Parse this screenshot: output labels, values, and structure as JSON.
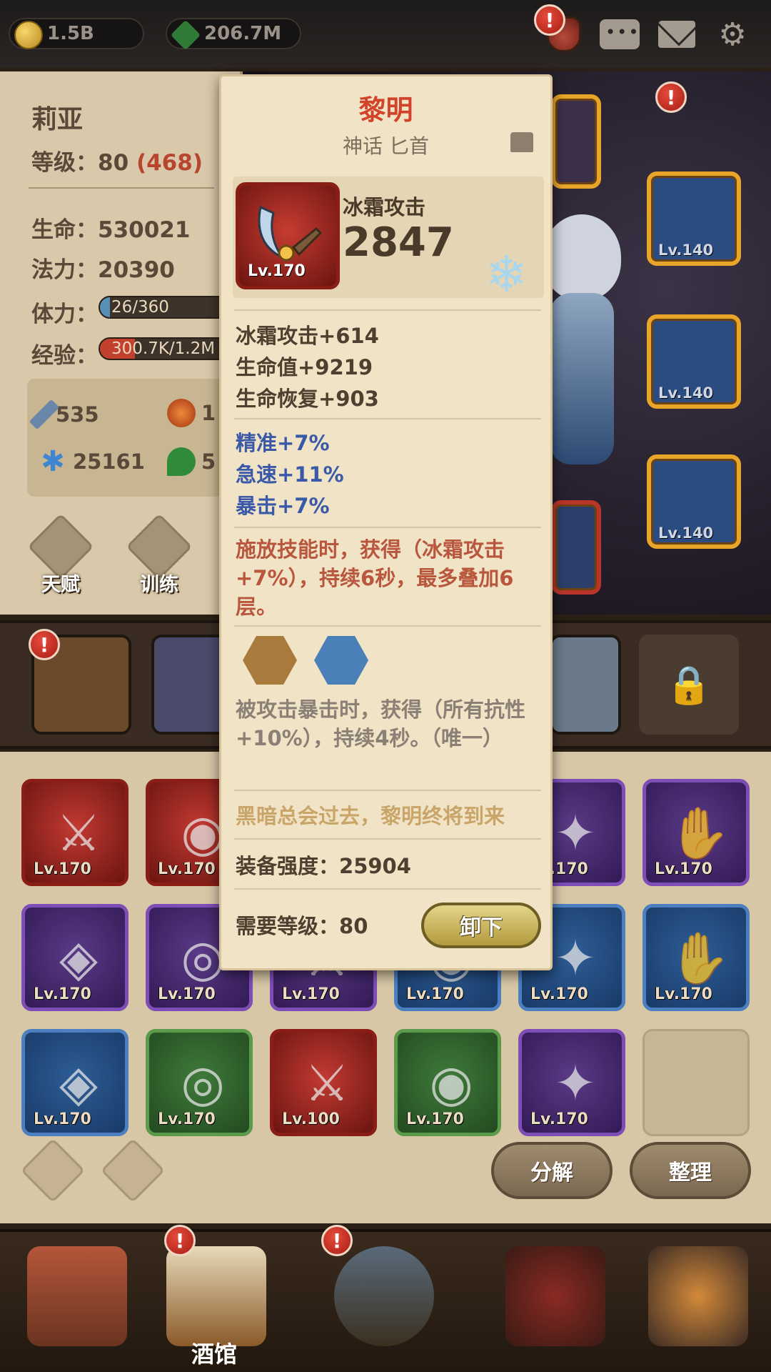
{
  "currencies": {
    "gold": "1.5B",
    "gems": "206.7M"
  },
  "top_icons": [
    "bag-icon",
    "chat-icon",
    "mail-icon",
    "gear-icon"
  ],
  "hero": {
    "name": "莉亚",
    "level_label": "等级：",
    "level": "80",
    "level_extra": "(468)",
    "hp_label": "生命：",
    "hp": "530021",
    "mp_label": "法力：",
    "mp": "20390",
    "stamina_label": "体力：",
    "stamina": "26/360",
    "stamina_fraction": 0.07,
    "exp_label": "经验：",
    "exp": "300.7K/1.2M",
    "exp_fraction": 0.25,
    "mini_stats": [
      {
        "icon": "sword-icon",
        "value": "535"
      },
      {
        "icon": "flame-icon",
        "value": "1"
      },
      {
        "icon": "frost-icon",
        "value": "25161"
      },
      {
        "icon": "leaf-icon",
        "value": "5"
      }
    ],
    "talent_label": "天赋",
    "training_label": "训练"
  },
  "equipped_slots": [
    {
      "level": "Lv.140"
    },
    {
      "level": "Lv.140"
    },
    {
      "level": "Lv.140"
    }
  ],
  "inventory": [
    {
      "level": "Lv.170",
      "rarity": "red"
    },
    {
      "level": "Lv.170",
      "rarity": "red"
    },
    {
      "level": "Lv.170",
      "rarity": "purple"
    },
    {
      "level": "Lv.170",
      "rarity": "purple"
    },
    {
      "level": "Lv.170",
      "rarity": "purple"
    },
    {
      "level": "Lv.170",
      "rarity": "purple"
    },
    {
      "level": "Lv.170",
      "rarity": "purple"
    },
    {
      "level": "Lv.170",
      "rarity": "blue"
    },
    {
      "level": "Lv.170",
      "rarity": "blue"
    },
    {
      "level": "Lv.170",
      "rarity": "blue"
    },
    {
      "level": "Lv.170",
      "rarity": "blue"
    },
    {
      "level": "Lv.170",
      "rarity": "green"
    },
    {
      "level": "Lv.100",
      "rarity": "red"
    },
    {
      "level": "Lv.170",
      "rarity": "green"
    },
    {
      "level": "Lv.170",
      "rarity": "purple"
    }
  ],
  "actions": {
    "decompose": "分解",
    "sort": "整理"
  },
  "nav": {
    "tavern": "酒馆"
  },
  "tooltip": {
    "name": "黎明",
    "subtitle": "神话 匕首",
    "item_level": "Lv.170",
    "main_stat_label": "冰霜攻击",
    "main_stat_value": "2847",
    "base_stats": [
      "冰霜攻击+614",
      "生命值+9219",
      "生命恢复+903"
    ],
    "bonus_stats": [
      "精准+7%",
      "急速+11%",
      "暴击+7%"
    ],
    "effect": "施放技能时，获得（冰霜攻击+7%），持续6秒，最多叠加6层。",
    "set_effect": "被攻击暴击时，获得（所有抗性+10%），持续4秒。（唯一）",
    "flavor": "黑暗总会过去，黎明终将到来",
    "power_label": "装备强度：",
    "power": "25904",
    "req_label": "需要等级：",
    "req_level": "80",
    "unequip": "卸下"
  },
  "colors": {
    "title_red": "#d2442a",
    "bonus_blue": "#3a59a8",
    "effect_red": "#b9573e",
    "gold_button": "#c9b24c"
  }
}
